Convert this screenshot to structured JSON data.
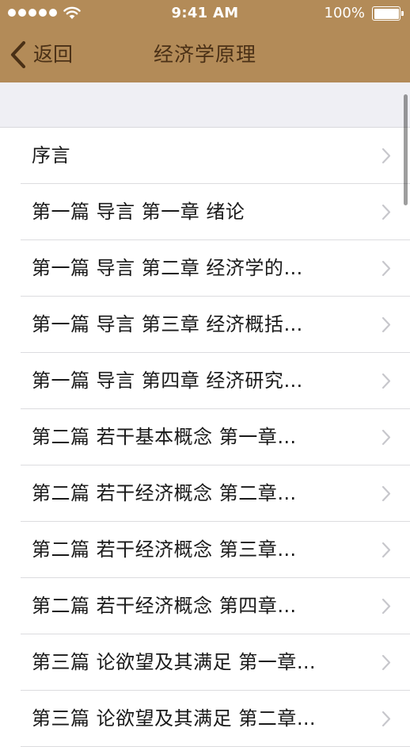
{
  "status_bar": {
    "time": "9:41 AM",
    "battery": "100%"
  },
  "nav": {
    "back_label": "返回",
    "title": "经济学原理"
  },
  "chapters": [
    "序言",
    "第一篇 导言 第一章 绪论",
    "第一篇 导言 第二章 经济学的…",
    "第一篇 导言 第三章 经济概括…",
    "第一篇 导言 第四章 经济研究…",
    "第二篇 若干基本概念 第一章…",
    "第二篇 若干经济概念 第二章…",
    "第二篇 若干经济概念 第三章…",
    "第二篇 若干经济概念 第四章…",
    "第三篇 论欲望及其满足 第一章…",
    "第三篇 论欲望及其满足 第二章…"
  ],
  "colors": {
    "nav_bar": "#b38b58",
    "nav_text": "#4a3016",
    "section_bg": "#efeff4",
    "disclosure": "#c7c7cc"
  },
  "icons": {
    "back": "chevron-left-icon",
    "row_accessory": "chevron-right-icon",
    "wifi": "wifi-icon",
    "battery": "battery-icon"
  }
}
